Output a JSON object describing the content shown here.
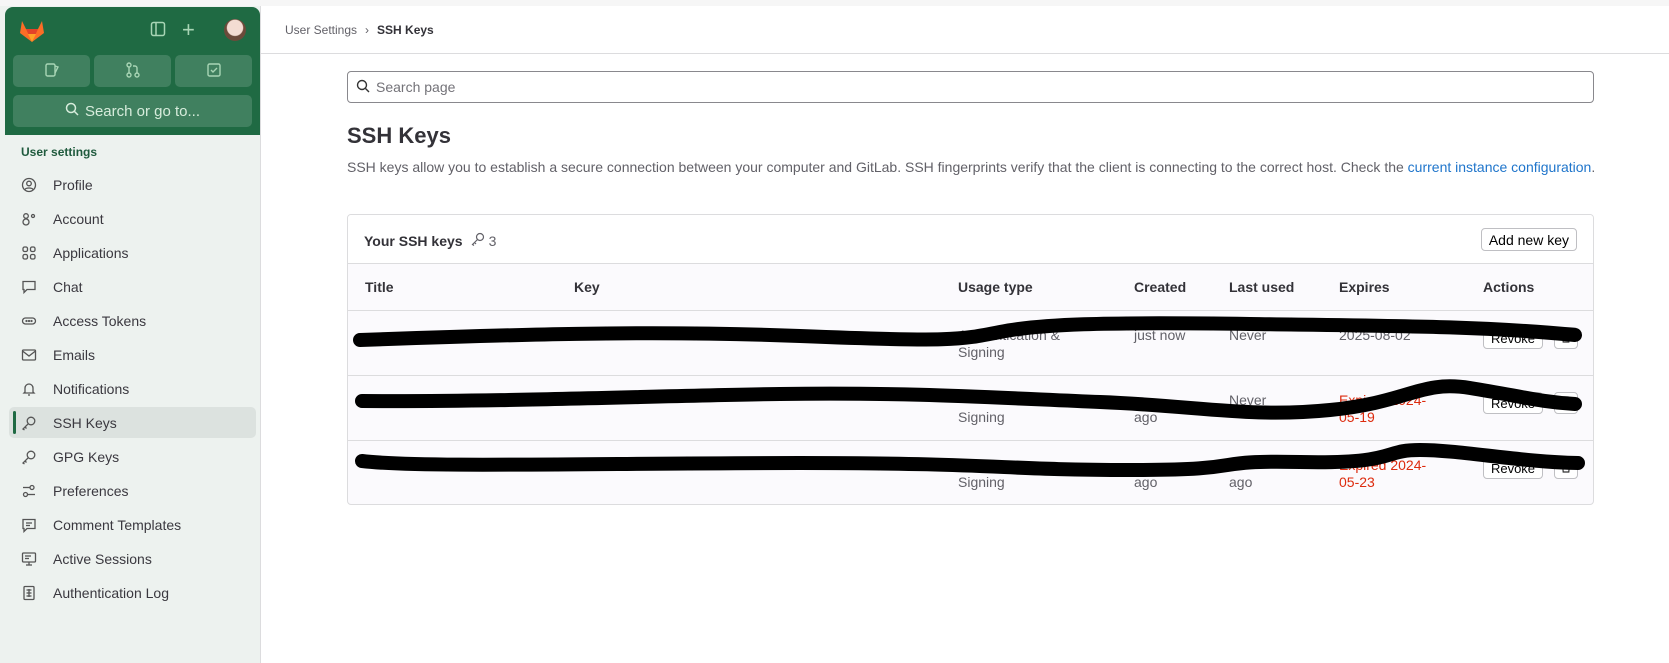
{
  "colors": {
    "sidebar_header": "#1f6a43",
    "link": "#1f75cb",
    "danger": "#dd2b0e"
  },
  "sidebar": {
    "search_label": "Search or go to...",
    "section_title": "User settings",
    "items": [
      {
        "label": "Profile",
        "icon": "profile-icon"
      },
      {
        "label": "Account",
        "icon": "account-icon"
      },
      {
        "label": "Applications",
        "icon": "applications-icon"
      },
      {
        "label": "Chat",
        "icon": "chat-icon"
      },
      {
        "label": "Access Tokens",
        "icon": "token-icon"
      },
      {
        "label": "Emails",
        "icon": "mail-icon"
      },
      {
        "label": "Notifications",
        "icon": "bell-icon"
      },
      {
        "label": "SSH Keys",
        "icon": "key-icon",
        "active": true
      },
      {
        "label": "GPG Keys",
        "icon": "key-icon"
      },
      {
        "label": "Preferences",
        "icon": "preferences-icon"
      },
      {
        "label": "Comment Templates",
        "icon": "comment-icon"
      },
      {
        "label": "Active Sessions",
        "icon": "monitor-icon"
      },
      {
        "label": "Authentication Log",
        "icon": "log-icon"
      }
    ]
  },
  "breadcrumb": {
    "parent": "User Settings",
    "separator": "›",
    "current": "SSH Keys"
  },
  "search": {
    "placeholder": "Search page"
  },
  "page": {
    "title": "SSH Keys",
    "description": "SSH keys allow you to establish a secure connection between your computer and GitLab. SSH fingerprints verify that the client is connecting to the correct host. Check the ",
    "link": "current instance configuration",
    "description_end": "."
  },
  "card": {
    "title": "Your SSH keys",
    "count": "3",
    "add_button": "Add new key",
    "columns": [
      "Title",
      "Key",
      "Usage type",
      "Created",
      "Last used",
      "Expires",
      "Actions"
    ],
    "rows": [
      {
        "usage_line1": "Authentication &",
        "usage_line2": "Signing",
        "created": "just now",
        "last_used": "Never",
        "expires": "2025-08-02",
        "expired": false,
        "revoke": "Revoke"
      },
      {
        "usage_line1": "",
        "usage_line2": "Signing",
        "created": "ago",
        "last_used": "Never",
        "expires": "Expired 2024-05-19",
        "expired": true,
        "revoke": "Revoke"
      },
      {
        "usage_line1": "",
        "usage_line2": "Signing",
        "created": "ago",
        "last_used": "ago",
        "expires": "Expired 2024-05-23",
        "expired": true,
        "revoke": "Revoke"
      }
    ]
  }
}
